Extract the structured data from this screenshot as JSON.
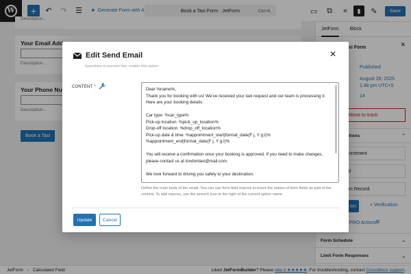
{
  "toolbar": {
    "logo_letter": "W",
    "add_label": "+",
    "generate_ai_label": "Generate Form with AI",
    "doc_title": "Book a Taxi Form · JetForm",
    "shortcut": "Ctrl+K",
    "save_label": "Save"
  },
  "canvas": {
    "top_desc": "Description...",
    "email_label": "Your Email Addre",
    "email_desc": "Description...",
    "phone_label": "Your Phone Num",
    "phone_desc": "Description...",
    "book_button": "Book a Taxi"
  },
  "sidebar": {
    "tabs": [
      "JetForm",
      "Block"
    ],
    "form_name": "xi Form",
    "status": "Published",
    "date": "August 28, 2025",
    "time": "1:48 pm UTC+5",
    "revisions": "14",
    "trash_label": "Move to trash",
    "actions_header": "ctions",
    "action_items": [
      "ointment",
      "il",
      "m Record"
    ],
    "new_action_label": "ion",
    "verification_label": "+ Verification",
    "pro_actions_label": "PRO Actions",
    "form_schedule": "Form Schedule",
    "limit_responses": "Limit Form Responses"
  },
  "footer": {
    "crumb_1": "JetForm",
    "crumb_2": "Calculated Field",
    "note_prefix": "Liked ",
    "note_brand": "JetFormBuilder",
    "note_mid": "? Please ",
    "note_link": "rate it ★★★★★",
    "note_suffix": ". For troubleshooting, contact ",
    "note_link2": "Crocoblock support",
    "note_end": "."
  },
  "modal": {
    "title": "Edit Send Email",
    "hidden_text": "hyperlinks to prevent this, enable this option",
    "content_label": "CONTENT",
    "required_mark": "*",
    "content_lines": [
      "Dear %name%,",
      "Thank you for booking with us! We've received your taxi request and our team is processing it.",
      "Here are your booking details:",
      "",
      "Car type: %car_type%",
      "Pick-up location: %pick_up_location%",
      "Drop-off location: %drop_off_location%",
      "Pick-up date & time: %appointment_start|format_date(F j, Y g:i)%",
      "%appointment_end|format_date(F j, Y g:i)%",
      "",
      "You will receive a confirmation once your booking is approved. If you need to make changes,",
      "please contact us at londontaxi@mail.com.",
      "",
      "We look forward to driving you safely to your destination."
    ],
    "help_text": "Define the main body of the email. You can use form field macros to insert the values of form fields as part of the content. To add macros, use the wrench icon to the right of the current option name.",
    "update_label": "Update",
    "cancel_label": "Cancel"
  },
  "colors": {
    "accent": "#2271b1",
    "danger": "#cc1818",
    "overlay": "rgba(0,0,0,0.35)"
  }
}
